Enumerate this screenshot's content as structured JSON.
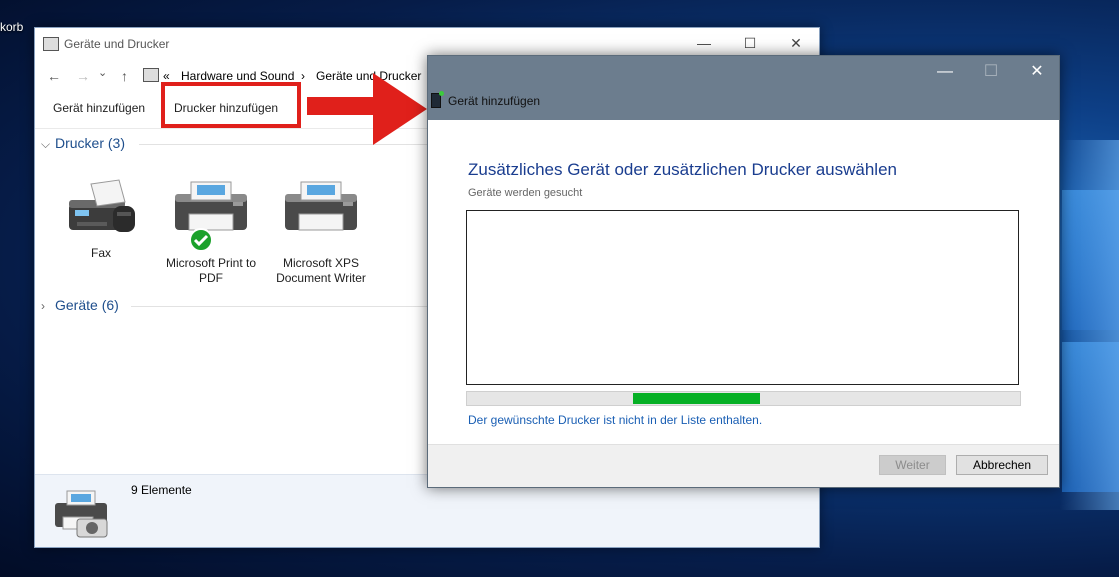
{
  "desktop": {
    "recycle_label": "korb"
  },
  "explorer": {
    "title": "Geräte und Drucker",
    "window_buttons": {
      "minimize": "—",
      "maximize": "☐",
      "close": "✕"
    },
    "nav": {
      "back": "←",
      "forward": "→",
      "down": "⌄",
      "up": "↑"
    },
    "breadcrumb": {
      "overflow": "«",
      "items": [
        "Hardware und Sound",
        "Geräte und Drucker"
      ],
      "separator": "›"
    },
    "toolbar": {
      "add_device": "Gerät hinzufügen",
      "add_printer": "Drucker hinzufügen"
    },
    "printers_group": "Drucker (3)",
    "devices_group": "Geräte (6)",
    "printers": [
      {
        "name": "Fax"
      },
      {
        "name": "Microsoft Print to PDF",
        "default": true
      },
      {
        "name": "Microsoft XPS Document Writer"
      }
    ],
    "status": {
      "count": "9 Elemente"
    }
  },
  "dialog": {
    "title": "Gerät hinzufügen",
    "buttons": {
      "minimize": "—",
      "maximize": "☐",
      "close": "✕"
    },
    "heading": "Zusätzliches Gerät oder zusätzlichen Drucker auswählen",
    "subheading": "Geräte werden gesucht",
    "progress_start": 0.3,
    "progress_end": 0.53,
    "not_listed_link": "Der gewünschte Drucker ist nicht in der Liste enthalten.",
    "next_button": "Weiter",
    "cancel_button": "Abbrechen"
  },
  "colors": {
    "accent_red": "#e0201b",
    "progress_green": "#06b025",
    "dialog_header": "#6c7d8e",
    "link_blue": "#1a5fb4"
  }
}
